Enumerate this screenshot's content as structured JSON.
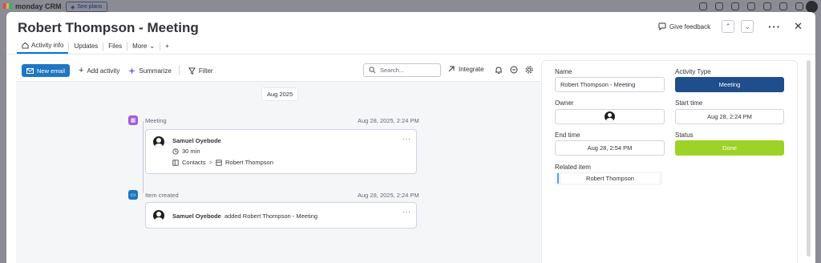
{
  "background": {
    "logo_text": "monday CRM",
    "plans_label": "See plans"
  },
  "modal": {
    "title": "Robert Thompson - Meeting",
    "feedback_label": "Give feedback"
  },
  "tabs": [
    {
      "label": "Activity info"
    },
    {
      "label": "Updates"
    },
    {
      "label": "Files"
    },
    {
      "label": "More"
    },
    {
      "label": "+"
    }
  ],
  "toolbar": {
    "new_email": "New email",
    "add_activity": "Add activity",
    "summarize": "Summarize",
    "filter": "Filter",
    "search_placeholder": "Search...",
    "integrate": "Integrate"
  },
  "timeline": {
    "date_chip": "Aug 2025",
    "events": [
      {
        "label": "Meeting",
        "time": "Aug 28, 2025, 2:24 PM",
        "icon_color": "#a25ddc",
        "person": "Samuel Oyebode",
        "duration": "30 min",
        "breadcrumb_board": "Contacts",
        "breadcrumb_sep": ">",
        "breadcrumb_item": "Robert Thompson"
      },
      {
        "label": "Item created",
        "time": "Aug 28, 2025, 2:24 PM",
        "icon_color": "#1f76c2",
        "person": "Samuel Oyebode",
        "action_text": "added Robert Thompson - Meeting"
      }
    ]
  },
  "details": {
    "name_label": "Name",
    "name_value": "Robert Thompson - Meeting",
    "activity_type_label": "Activity Type",
    "activity_type_value": "Meeting",
    "activity_type_color": "#1f4e8c",
    "owner_label": "Owner",
    "start_time_label": "Start time",
    "start_time_value": "Aug 28, 2:24 PM",
    "end_time_label": "End time",
    "end_time_value": "Aug 28, 2:54 PM",
    "status_label": "Status",
    "status_value": "Done",
    "status_color": "#9cd326",
    "related_label": "Related item",
    "related_value": "Robert Thompson"
  }
}
